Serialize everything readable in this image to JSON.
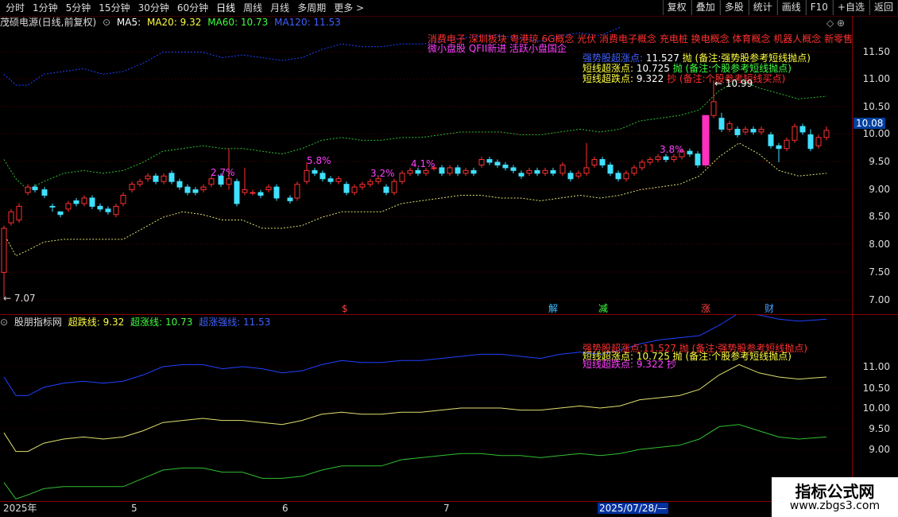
{
  "toolbar": {
    "periods": [
      "分时",
      "1分钟",
      "5分钟",
      "15分钟",
      "30分钟",
      "60分钟",
      "日线",
      "周线",
      "月线",
      "多周期",
      "更多 >"
    ],
    "active_period": "日线",
    "buttons": [
      "复权",
      "叠加",
      "多股",
      "统计",
      "画线",
      "F10",
      "+自选",
      "返回"
    ]
  },
  "info": {
    "stock": "茂硕电源(日线,前复权)",
    "ma5_label": "MA5:",
    "ma20": "MA20: 9.32",
    "ma60": "MA60: 10.73",
    "ma120": "MA120: 11.53"
  },
  "concepts": {
    "line1": "消费电子  深圳板块  粤港琼  6G概念  光伏  消费电子概念  充电桩  换电概念  体育概念  机器人概念  新零售",
    "line2": "微小盘股  QFII新进  活跃小盘国企"
  },
  "main_annotations": {
    "row1_label": "强势股超涨点:",
    "row1_value": "11.527",
    "row1_action": "抛",
    "row1_note": "(备注:强势股参考短线抛点)",
    "row2_label": "短线超涨点:",
    "row2_value": "10.725",
    "row2_action": "抛",
    "row2_note": "(备注:个股参考短线抛点)",
    "row3_label": "短线超跌点:",
    "row3_value": "9.322",
    "row3_action": "抄",
    "row3_note": "(备注:个股参考短线买点)"
  },
  "price_markers": {
    "high": "← 10.99",
    "low": "← 7.07",
    "current": "10.08"
  },
  "pct_labels": [
    "2.7%",
    "5.8%",
    "3.2%",
    "4.1%",
    "3.8%"
  ],
  "event_markers": [
    {
      "text": "$",
      "color": "#ff4040"
    },
    {
      "text": "解",
      "color": "#40c0ff"
    },
    {
      "text": "减",
      "color": "#40ff40"
    },
    {
      "text": "涨",
      "color": "#ff4040"
    },
    {
      "text": "财",
      "color": "#40a0ff"
    }
  ],
  "main_y_labels": [
    "11.50",
    "11.00",
    "10.50",
    "10.00",
    "9.50",
    "9.00",
    "8.50",
    "8.00",
    "7.50",
    "7.00"
  ],
  "indicator": {
    "name": "股朋指标网",
    "l1": "超跌线: 9.32",
    "l2": "超涨线: 10.73",
    "l3": "超涨强线: 11.53",
    "vals": ": 9.32 : 10.73 : 11.53"
  },
  "ind_annotations": {
    "row1": "强势股超涨点:11.527  抛  (备注:强势股参考短线抛点)",
    "row2": "短线超涨点:  10.725  抛  (备注:个股参考短线抛点)",
    "row3": "短线超跌点:  9.322  抄"
  },
  "ind_y_labels": [
    "11.00",
    "10.50",
    "10.00",
    "9.50",
    "9.00"
  ],
  "date_labels": [
    "2025年",
    "5",
    "6",
    "7"
  ],
  "date_highlight": "2025/07/28/—",
  "watermark": {
    "title": "指标公式网",
    "url": "www.zbgs3.com"
  },
  "colors": {
    "up": "#ff3030",
    "down": "#40e0ff",
    "ma5": "#ffffff",
    "ma20": "#ffff40",
    "ma60": "#40ff40",
    "ma120": "#4060ff",
    "pct": "#ff40ff"
  }
}
